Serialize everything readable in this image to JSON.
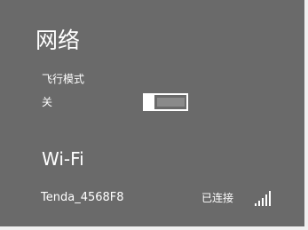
{
  "panel": {
    "title": "网络"
  },
  "airplane_mode": {
    "label": "飞行模式",
    "state_label": "关",
    "enabled": false
  },
  "wifi": {
    "heading": "Wi-Fi",
    "networks": [
      {
        "name": "Tenda_4568F8",
        "status": "已连接",
        "signal_icon": "wifi-signal-icon",
        "signal_bars": 5
      }
    ]
  }
}
